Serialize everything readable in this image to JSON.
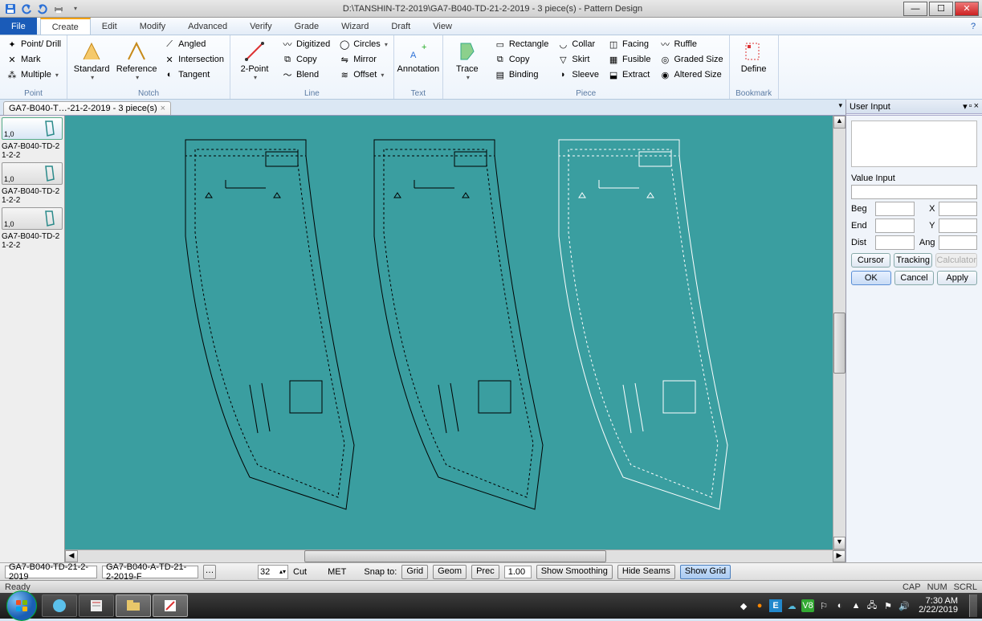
{
  "title": "D:\\TANSHIN-T2-2019\\GA7-B040-TD-21-2-2019 - 3 piece(s) - Pattern Design",
  "menu": {
    "file": "File",
    "create": "Create",
    "edit": "Edit",
    "modify": "Modify",
    "advanced": "Advanced",
    "verify": "Verify",
    "grade": "Grade",
    "wizard": "Wizard",
    "draft": "Draft",
    "view": "View"
  },
  "ribbon": {
    "point": {
      "label": "Point",
      "pointdrill": "Point/ Drill",
      "mark": "Mark",
      "multiple": "Multiple"
    },
    "notch": {
      "label": "Notch",
      "standard": "Standard",
      "reference": "Reference",
      "angled": "Angled",
      "intersection": "Intersection",
      "tangent": "Tangent"
    },
    "line": {
      "label": "Line",
      "twopoint": "2-Point",
      "digitized": "Digitized",
      "copy": "Copy",
      "blend": "Blend",
      "circles": "Circles",
      "mirror": "Mirror",
      "offset": "Offset"
    },
    "text": {
      "label": "Text",
      "annotation": "Annotation"
    },
    "piece": {
      "label": "Piece",
      "trace": "Trace",
      "rectangle": "Rectangle",
      "copy": "Copy",
      "binding": "Binding",
      "collar": "Collar",
      "skirt": "Skirt",
      "sleeve": "Sleeve",
      "facing": "Facing",
      "fusible": "Fusible",
      "extract": "Extract",
      "ruffle": "Ruffle",
      "gradedsize": "Graded Size",
      "alteredsize": "Altered Size"
    },
    "bookmark": {
      "label": "Bookmark",
      "define": "Define"
    }
  },
  "doctab": "GA7-B040-T…-21-2-2019  - 3 piece(s)",
  "pieces": {
    "p1": "GA7-B040-TD-21-2-2",
    "p2": "GA7-B040-TD-21-2-2",
    "p3": "GA7-B040-TD-21-2-2",
    "num": "1,0"
  },
  "userinput": {
    "title": "User Input",
    "valueinput": "Value Input",
    "beg": "Beg",
    "end": "End",
    "dist": "Dist",
    "x": "X",
    "y": "Y",
    "ang": "Ang",
    "cursor": "Cursor",
    "tracking": "Tracking",
    "calculator": "Calculator",
    "ok": "OK",
    "cancel": "Cancel",
    "apply": "Apply"
  },
  "quick": {
    "file1": "GA7-B040-TD-21-2-2019",
    "file2": "GA7-B040-A-TD-21-2-2019-F",
    "spin": "32",
    "cut": "Cut",
    "met": "MET",
    "snap": "Snap to:",
    "grid": "Grid",
    "geom": "Geom",
    "prec": "Prec",
    "val": "1.00",
    "showsmoothing": "Show Smoothing",
    "hideseams": "Hide Seams",
    "showgrid": "Show Grid"
  },
  "status": {
    "ready": "Ready",
    "cap": "CAP",
    "num": "NUM",
    "scrl": "SCRL"
  },
  "clock": {
    "time": "7:30 AM",
    "date": "2/22/2019"
  }
}
